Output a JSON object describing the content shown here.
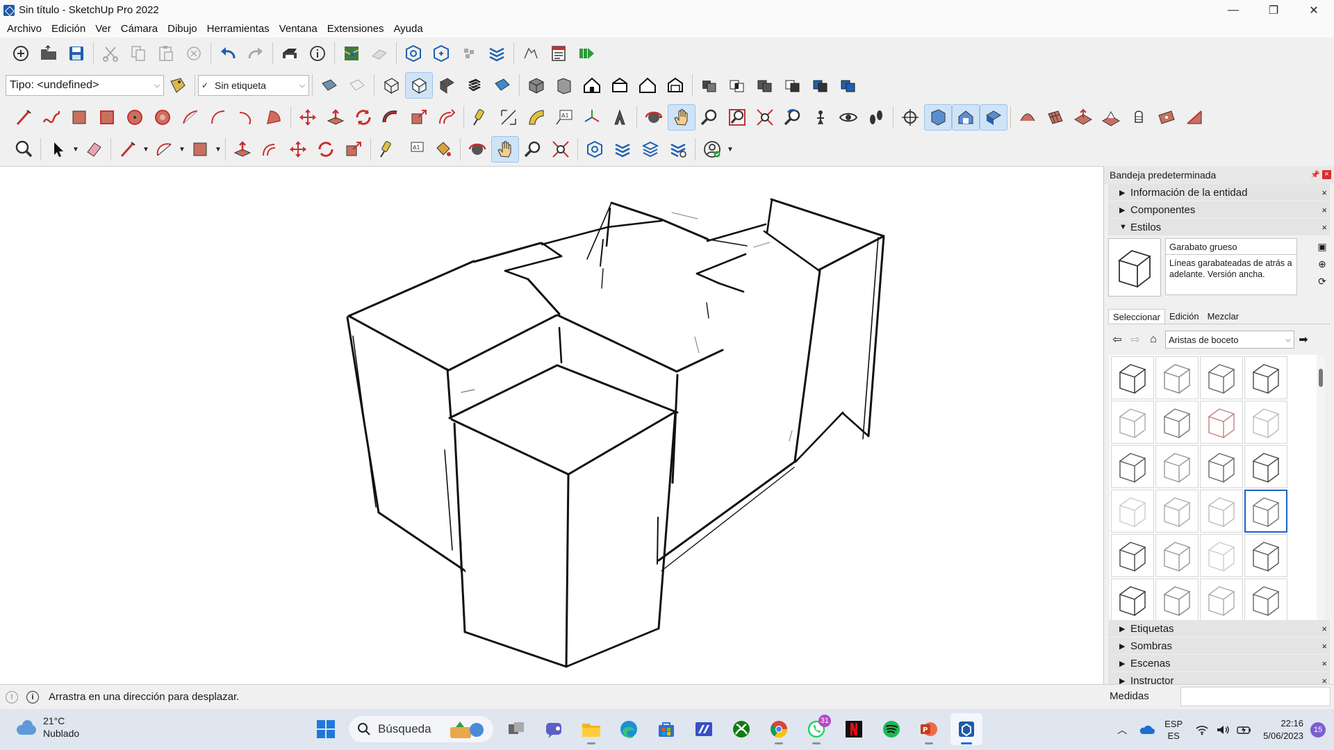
{
  "window": {
    "title": "Sin título - SketchUp Pro 2022",
    "minimize": "—",
    "maximize": "❐",
    "close": "✕"
  },
  "menu": [
    "Archivo",
    "Edición",
    "Ver",
    "Cámara",
    "Dibujo",
    "Herramientas",
    "Ventana",
    "Extensiones",
    "Ayuda"
  ],
  "toolbar": {
    "type_combo": "Tipo: <undefined>",
    "tag_combo": "Sin etiqueta",
    "tag_check": "✓"
  },
  "tray": {
    "title": "Bandeja predeterminada",
    "panels_top": [
      {
        "label": "Información de la entidad",
        "state": "collapsed"
      },
      {
        "label": "Componentes",
        "state": "collapsed"
      },
      {
        "label": "Estilos",
        "state": "expanded"
      }
    ],
    "style": {
      "name": "Garabato grueso",
      "description": "Líneas garabateadas de atrás a adelante.  Versión ancha."
    },
    "tabs": [
      "Seleccionar",
      "Edición",
      "Mezclar"
    ],
    "active_tab": "Seleccionar",
    "library": "Aristas de boceto",
    "thumb_count": 24,
    "selected_thumb": 15,
    "panels_bottom": [
      {
        "label": "Etiquetas",
        "state": "collapsed"
      },
      {
        "label": "Sombras",
        "state": "collapsed"
      },
      {
        "label": "Escenas",
        "state": "collapsed"
      },
      {
        "label": "Instructor",
        "state": "collapsed"
      }
    ]
  },
  "status": {
    "message": "Arrastra en una dirección para desplazar.",
    "measure_label": "Medidas",
    "measure_value": ""
  },
  "taskbar": {
    "weather_temp": "21°C",
    "weather_desc": "Nublado",
    "search_placeholder": "Búsqueda",
    "whatsapp_badge": "31",
    "lang_top": "ESP",
    "lang_bottom": "ES",
    "time": "22:16",
    "date": "5/06/2023",
    "notifications": "15"
  }
}
